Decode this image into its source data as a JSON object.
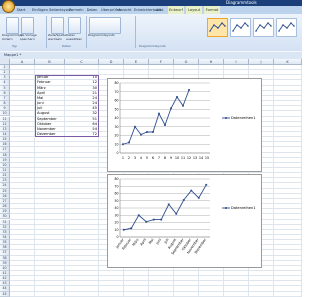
{
  "window": {
    "title": "Diagrammtools"
  },
  "ribbon": {
    "tabs": [
      "Start",
      "Einfügen",
      "Seitenlayout",
      "Formeln",
      "Daten",
      "Überprüfen",
      "Ansicht",
      "Entwicklertools",
      "Add-Ins",
      "Entwurf",
      "Layout",
      "Format"
    ],
    "buttons": [
      {
        "label": "Diagrammtyp ändern"
      },
      {
        "label": "Als Vorlage speichern"
      },
      {
        "label": "Zeile/Spalte wechseln"
      },
      {
        "label": "Daten auswählen"
      },
      {
        "label": "Diagrammlayouts"
      }
    ],
    "groups": [
      "Typ",
      "Daten",
      "Diagrammlayouts"
    ]
  },
  "formula_bar": {
    "name_box": "Diagramm 1",
    "fx": "fx"
  },
  "workbook": {
    "tab": "Mappe1 *"
  },
  "sheet": {
    "columns": [
      "A",
      "B",
      "C",
      "D",
      "E",
      "F",
      "G",
      "H",
      "I",
      "J",
      "K"
    ],
    "rows": [
      "1",
      "2",
      "3",
      "4",
      "5",
      "6",
      "7",
      "8",
      "9",
      "10",
      "11",
      "12",
      "13",
      "14",
      "15",
      "16",
      "17",
      "18",
      "19",
      "20",
      "21",
      "22",
      "23",
      "24",
      "25",
      "26",
      "27",
      "28",
      "29",
      "30",
      "31",
      "32",
      "33",
      "34",
      "35",
      "36",
      "37",
      "38",
      "39",
      "40",
      "41",
      "42",
      "43",
      "44",
      "45"
    ],
    "data": [
      {
        "month": "Januar",
        "value": "10"
      },
      {
        "month": "Februar",
        "value": "12"
      },
      {
        "month": "März",
        "value": "30"
      },
      {
        "month": "April",
        "value": "21"
      },
      {
        "month": "Mai",
        "value": "24"
      },
      {
        "month": "Juni",
        "value": "24"
      },
      {
        "month": "Juli",
        "value": "45"
      },
      {
        "month": "August",
        "value": "32"
      },
      {
        "month": "September",
        "value": "51"
      },
      {
        "month": "Oktober",
        "value": "64"
      },
      {
        "month": "November",
        "value": "54"
      },
      {
        "month": "Dezember",
        "value": "72"
      }
    ]
  },
  "chart_data": [
    {
      "type": "line",
      "title": "",
      "x": [
        1,
        2,
        3,
        4,
        5,
        6,
        7,
        8,
        9,
        10,
        11,
        12
      ],
      "x_ticks": [
        "1",
        "2",
        "3",
        "4",
        "5",
        "6",
        "7",
        "8",
        "9",
        "10",
        "11",
        "12",
        "13",
        "14",
        "15"
      ],
      "series": [
        {
          "name": "Datenreihen1",
          "values": [
            10,
            12,
            30,
            21,
            24,
            24,
            45,
            32,
            51,
            64,
            54,
            72
          ]
        }
      ],
      "y_ticks": [
        "0",
        "10",
        "20",
        "30",
        "40",
        "50",
        "60",
        "70",
        "80"
      ],
      "ylim": [
        0,
        80
      ],
      "grid": true,
      "legend": "right"
    },
    {
      "type": "line",
      "title": "",
      "categories": [
        "Januar",
        "Februar",
        "März",
        "April",
        "Mai",
        "Juni",
        "Juli",
        "August",
        "September",
        "Oktober",
        "November",
        "Dezember"
      ],
      "series": [
        {
          "name": "Datenreihen1",
          "values": [
            10,
            12,
            30,
            21,
            24,
            24,
            45,
            32,
            51,
            64,
            54,
            72
          ]
        }
      ],
      "y_ticks": [
        "0",
        "10",
        "20",
        "30",
        "40",
        "50",
        "60",
        "70",
        "80"
      ],
      "ylim": [
        0,
        80
      ],
      "grid": true,
      "legend": "right"
    }
  ],
  "colors": {
    "line": "#2f4f8f",
    "ribbon": "#d4e2f4",
    "context_tab": "#e9f0ca",
    "selection": "#7a5aa6"
  }
}
